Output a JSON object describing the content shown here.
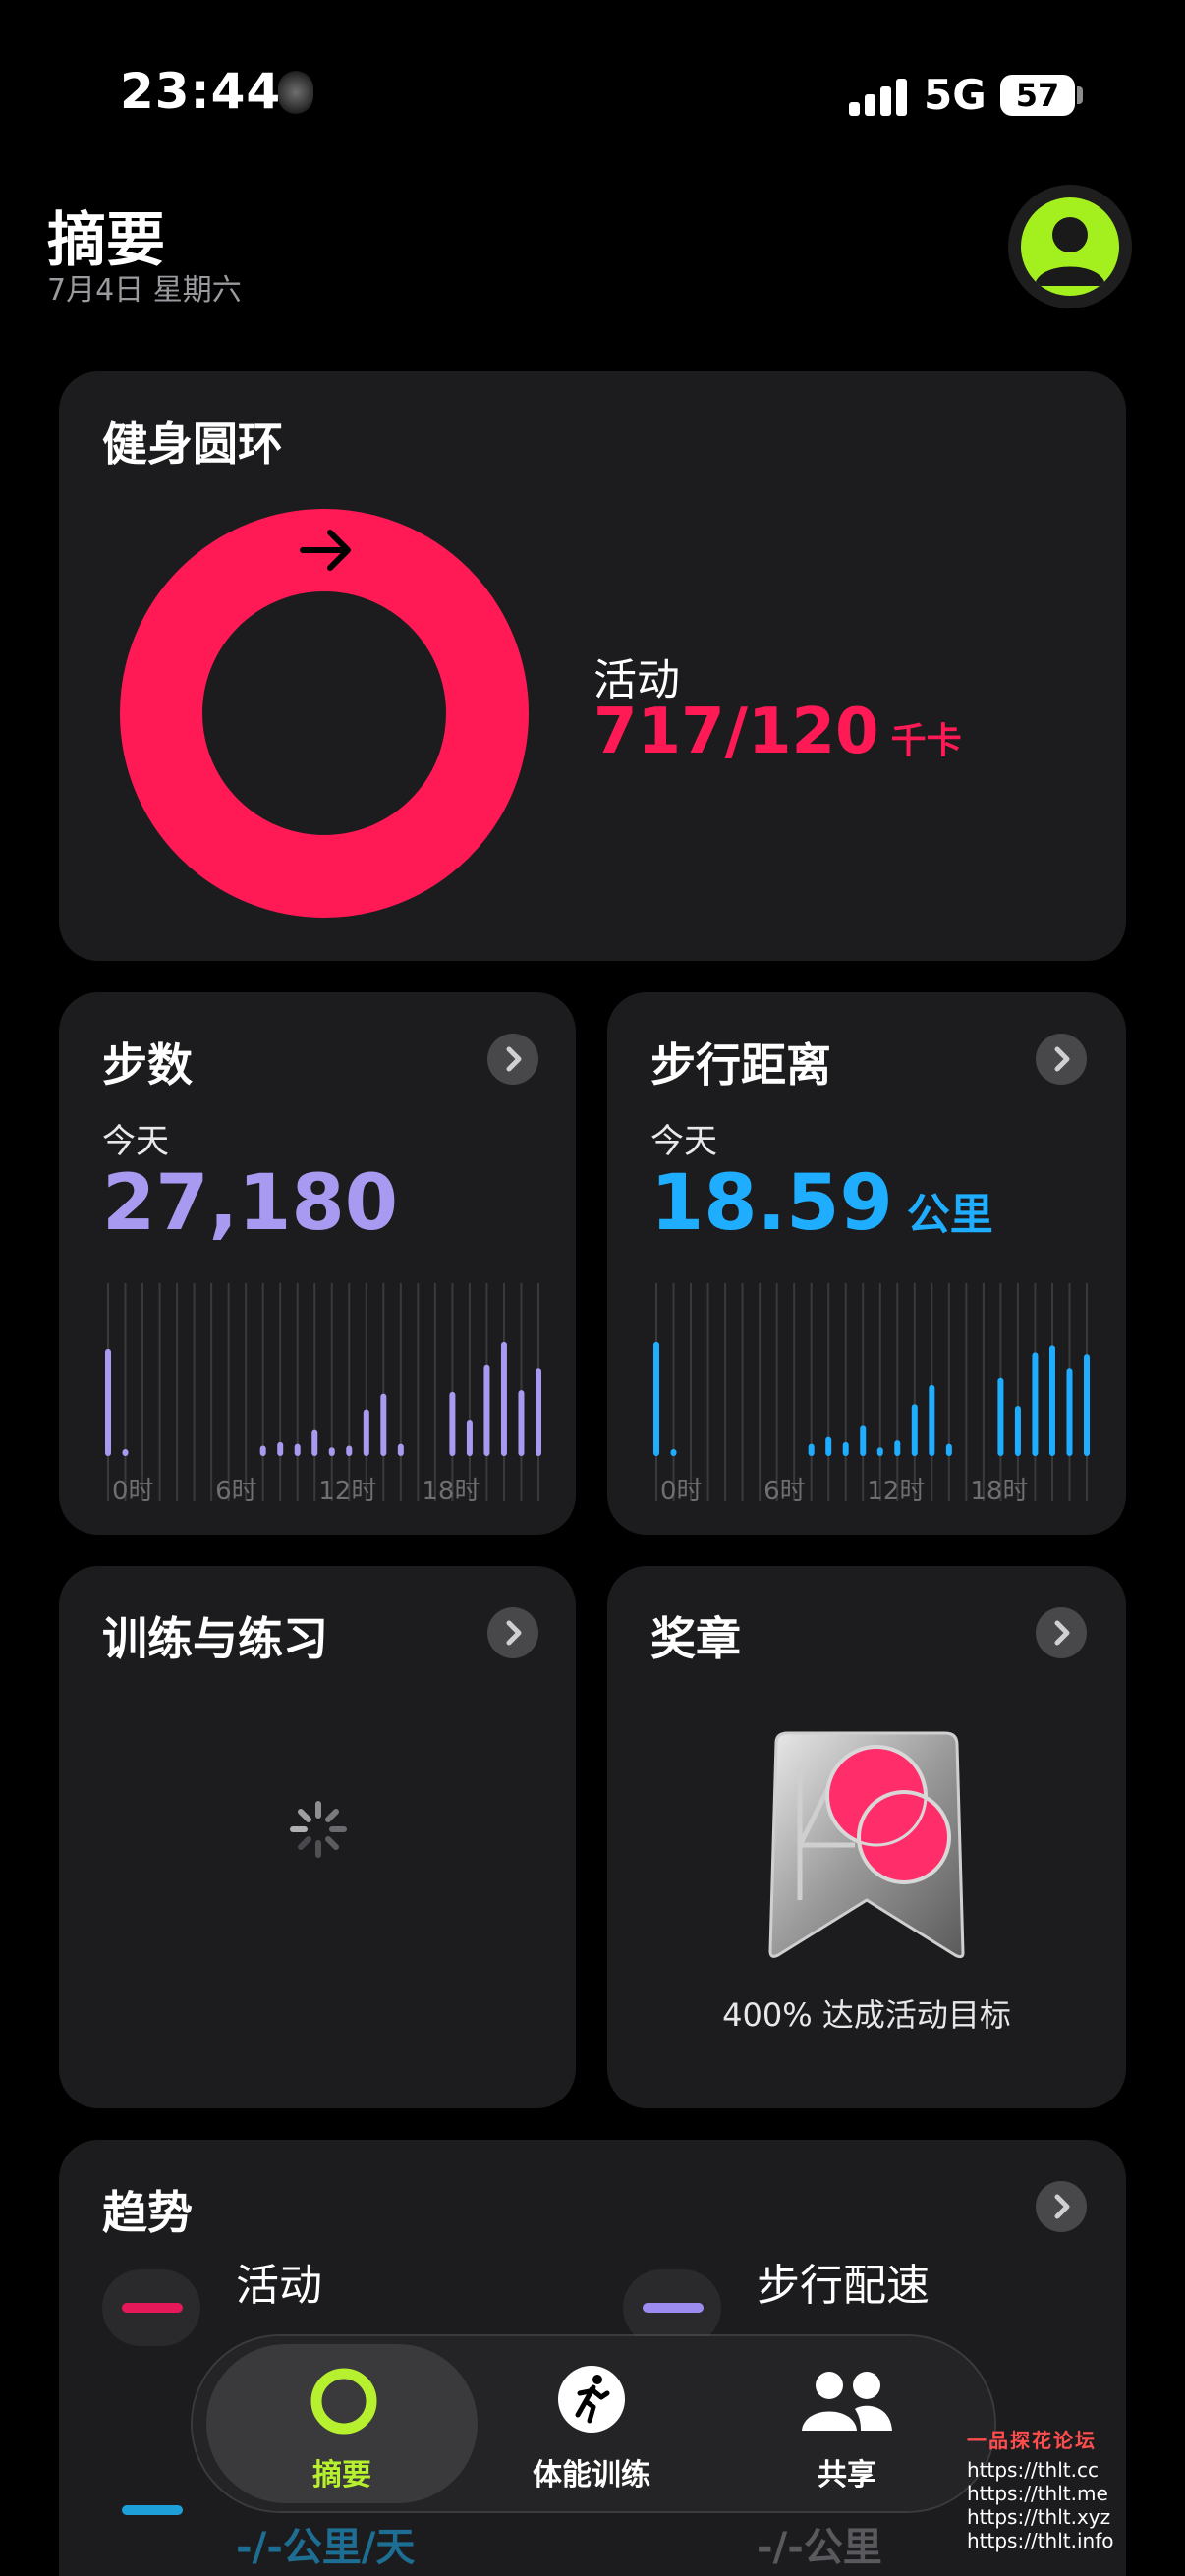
{
  "status_bar": {
    "time": "23:44",
    "network": "5G",
    "battery": "57"
  },
  "header": {
    "title": "摘要",
    "date": "7月4日 星期六"
  },
  "rings_card": {
    "title": "健身圆环",
    "move_label": "活动",
    "move_value": "717/120",
    "move_unit": "千卡",
    "move_progress_percent": 597,
    "ring_color": "#ff1a56"
  },
  "steps_card": {
    "title": "步数",
    "sub": "今天",
    "value": "27,180",
    "color": "#a79af0",
    "ticks": [
      "0时",
      "6时",
      "12时",
      "18时"
    ],
    "bars": [
      0.62,
      0.04,
      0,
      0,
      0,
      0,
      0,
      0,
      0,
      0.06,
      0.08,
      0.07,
      0.15,
      0.05,
      0.06,
      0.27,
      0.36,
      0.07,
      0,
      0,
      0.37,
      0.21,
      0.53,
      0.66,
      0.38,
      0.51
    ]
  },
  "distance_card": {
    "title": "步行距离",
    "sub": "今天",
    "value": "18.59",
    "unit": "公里",
    "color": "#1faeff",
    "ticks": [
      "0时",
      "6时",
      "12时",
      "18时"
    ],
    "bars": [
      0.66,
      0.04,
      0,
      0,
      0,
      0,
      0,
      0,
      0,
      0.07,
      0.11,
      0.08,
      0.18,
      0.05,
      0.09,
      0.3,
      0.41,
      0.07,
      0,
      0,
      0.45,
      0.29,
      0.6,
      0.64,
      0.51,
      0.59
    ]
  },
  "workouts_card": {
    "title": "训练与练习"
  },
  "awards_card": {
    "title": "奖章",
    "badge_caption": "400% 达成活动目标",
    "badge_color": "#ff2d6a"
  },
  "trends_card": {
    "title": "趋势",
    "items": [
      {
        "label": "活动",
        "color": "#e5195a"
      },
      {
        "label": "步行配速",
        "color": "#9d8cf0"
      },
      {
        "label": "-/-公里/天",
        "color": "#1e9fd8"
      },
      {
        "label": "-/-公里",
        "color": "#8b8b90"
      }
    ]
  },
  "tab_bar": {
    "tabs": [
      {
        "label": "摘要",
        "color": "#b6f02e"
      },
      {
        "label": "体能训练",
        "color": "#ffffff"
      },
      {
        "label": "共享",
        "color": "#ffffff"
      }
    ]
  },
  "watermark": {
    "lines": [
      "一品探花论坛",
      "https://thlt.cc",
      "https://thlt.me",
      "https://thlt.xyz",
      "https://thlt.info"
    ]
  }
}
